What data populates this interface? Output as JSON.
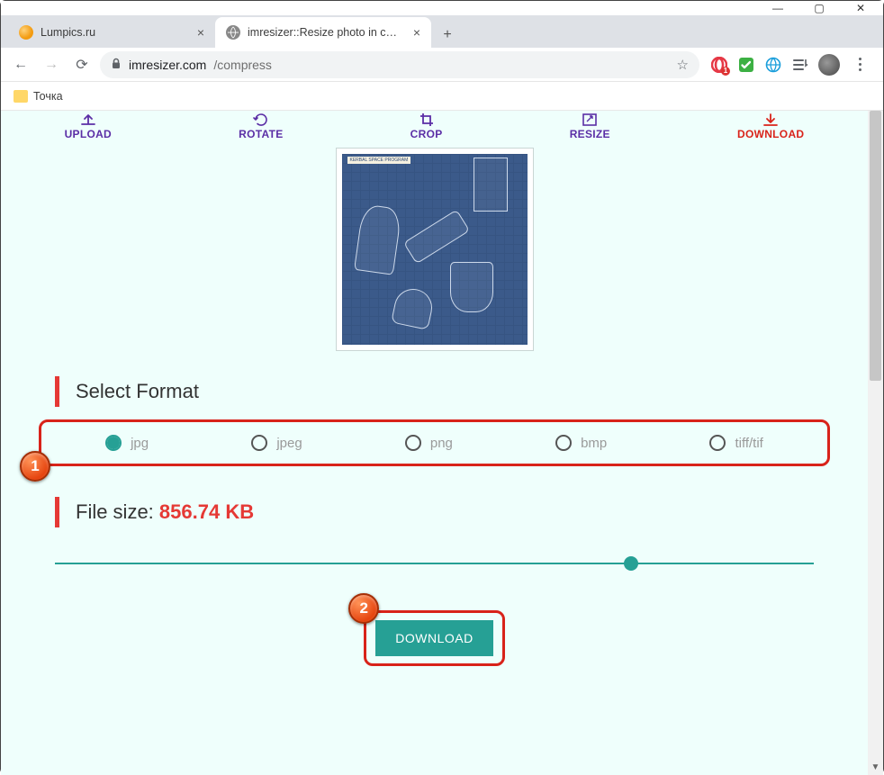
{
  "window": {
    "minimize": "—",
    "maximize": "▢",
    "close": "✕"
  },
  "tabs": [
    {
      "title": "Lumpics.ru",
      "active": false
    },
    {
      "title": "imresizer::Resize photo in cm, mm",
      "active": true
    }
  ],
  "newtab": "+",
  "nav": {
    "back": "←",
    "forward": "→",
    "reload": "⟳"
  },
  "address": {
    "lock": "🔒",
    "domain": "imresizer.com",
    "path": "/compress",
    "star": "☆"
  },
  "extensions": {
    "opera_badge": "1"
  },
  "bookmarks": {
    "folder_label": "Точка"
  },
  "steps": {
    "upload": "UPLOAD",
    "rotate": "ROTATE",
    "crop": "CROP",
    "resize": "RESIZE",
    "download": "DOWNLOAD"
  },
  "preview": {
    "bp_label": "KERBAL SPACE PROGRAM"
  },
  "select_format": {
    "heading": "Select Format",
    "options": {
      "jpg": "jpg",
      "jpeg": "jpeg",
      "png": "png",
      "bmp": "bmp",
      "tiff": "tiff/tif"
    },
    "selected": "jpg"
  },
  "file_size": {
    "label": "File size: ",
    "value": "856.74 KB"
  },
  "slider": {
    "percent": 75
  },
  "download_button": "DOWNLOAD",
  "callouts": {
    "one": "1",
    "two": "2"
  },
  "colors": {
    "accent_teal": "#26a095",
    "accent_red": "#d8231a",
    "step_purple": "#5b2ea6",
    "page_bg": "#effffc"
  }
}
